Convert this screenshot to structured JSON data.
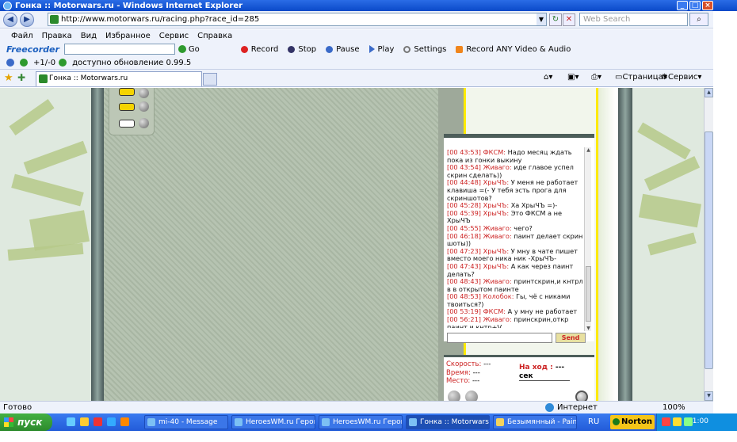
{
  "window": {
    "title": "Гонка :: Motorwars.ru - Windows Internet Explorer",
    "url": "http://www.motorwars.ru/racing.php?race_id=285",
    "search_placeholder": "Web Search"
  },
  "menu": [
    "Файл",
    "Правка",
    "Вид",
    "Избранное",
    "Сервис",
    "Справка"
  ],
  "freecorder": {
    "logo": "Freecorder",
    "go": "Go",
    "record": "Record",
    "stop": "Stop",
    "pause": "Pause",
    "play": "Play",
    "settings": "Settings",
    "record_any": "Record ANY Video & Audio"
  },
  "update_bar": {
    "rating": "+1/-0",
    "update_text": "доступно обновление 0.99.5"
  },
  "tabs": {
    "active_tab": "Гонка :: Motorwars.ru",
    "page_menu": "Страница",
    "tools_menu": "Сервис"
  },
  "chat": {
    "messages": [
      {
        "time": "[00 43:53]",
        "nick": "ФКСМ:",
        "text": "Надо месяц ждать пока из гонки выкину"
      },
      {
        "time": "[00 43:54]",
        "nick": "Живаго:",
        "text": "иде главое успел скрин сделать))"
      },
      {
        "time": "[00 44:48]",
        "nick": "ХрыЧЪ:",
        "text": "У меня не работает клавиша =(- У тебя эсть прога для скриншотов?"
      },
      {
        "time": "[00 45:28]",
        "nick": "ХрыЧЪ:",
        "text": "Ха ХрыЧЪ =)-"
      },
      {
        "time": "[00 45:39]",
        "nick": "ХрыЧЪ:",
        "text": "Это ФКСМ а не ХрыЧЪ"
      },
      {
        "time": "[00 45:55]",
        "nick": "Живаго:",
        "text": "чего?"
      },
      {
        "time": "[00 46:18]",
        "nick": "Живаго:",
        "text": "паинт делает скрин шоты))"
      },
      {
        "time": "[00 47:23]",
        "nick": "ХрыЧЪ:",
        "text": "У мну в чате пишет вместо моего ника ник -ХрыЧЪ-"
      },
      {
        "time": "[00 47:43]",
        "nick": "ХрыЧЪ:",
        "text": "А как через паинт делать?"
      },
      {
        "time": "[00 48:43]",
        "nick": "Живаго:",
        "text": "принтскрин,и кнтрл в в открытом паинте"
      },
      {
        "time": "[00 48:53]",
        "nick": "Колобок:",
        "text": "Гы, чё с никами твоиться?)"
      },
      {
        "time": "[00 53:19]",
        "nick": "ФКСМ:",
        "text": "А у мну не работает"
      },
      {
        "time": "[00 56:21]",
        "nick": "Живаго:",
        "text": "принскрин,откр паинт и кнтр+V"
      }
    ],
    "send_label": "Send"
  },
  "stats": {
    "speed_label": "Скорость:",
    "speed_value": "---",
    "time_label": "Время:",
    "time_value": "---",
    "place_label": "Место:",
    "place_value": "---",
    "turn_label": "На ход :",
    "turn_value": "--- сек"
  },
  "statusbar": {
    "status": "Готово",
    "zone": "Интернет",
    "zoom": "100%"
  },
  "taskbar": {
    "start": "пуск",
    "items": [
      "mi-40 - Message",
      "HeroesWM.ru Герои...",
      "HeroesWM.ru Герои...",
      "Гонка :: Motorwars...",
      "Безымянный - Paint"
    ],
    "lang": "RU",
    "norton": "Norton",
    "clock": "1:00"
  },
  "colors": {
    "chat_nick": "#cc2222",
    "accent_yellow": "#ffea00",
    "panel_dark": "#4d5e5a"
  }
}
